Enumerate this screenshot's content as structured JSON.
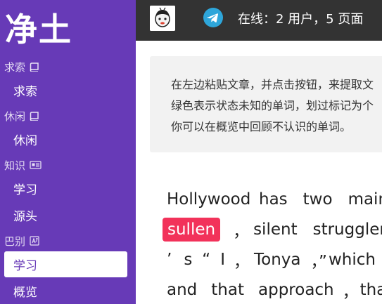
{
  "sidebar": {
    "brand": "净土",
    "sections": [
      {
        "label": "求索",
        "icon": "book-icon"
      },
      {
        "label": "休闲",
        "icon": "book-icon"
      },
      {
        "label": "知识",
        "icon": "newspaper-icon"
      },
      {
        "label": "巴别",
        "icon": "translate-icon"
      }
    ],
    "items": [
      "求索",
      "休闲",
      "学习",
      "源头",
      "学习",
      "概览"
    ]
  },
  "topbar": {
    "online_text": "在线：2 用户，5 页面",
    "avatar_icon": "avatar-icon",
    "telegram_icon": "telegram-icon"
  },
  "notice": {
    "lines": [
      "在左边粘贴文章，并点击按钮，来提取文",
      "绿色表示状态未知的单词，划过标记为个",
      "你可以在概览中回顾不认识的单词。"
    ]
  },
  "article": {
    "line1": [
      "Hollywood",
      "has",
      "two",
      "main"
    ],
    "line2": [
      "sullen",
      "，",
      "silent",
      "strugglers"
    ],
    "line3": [
      "’",
      "s",
      "“",
      "I",
      "，",
      "Tonya",
      "，”",
      "which"
    ],
    "line4": [
      "and",
      "that",
      "approach",
      "，",
      "that"
    ]
  },
  "colors": {
    "sidebar": "#673ab7",
    "topbar": "#333333",
    "highlight": "#f2325a",
    "notice_bg": "#f2f2f2"
  }
}
